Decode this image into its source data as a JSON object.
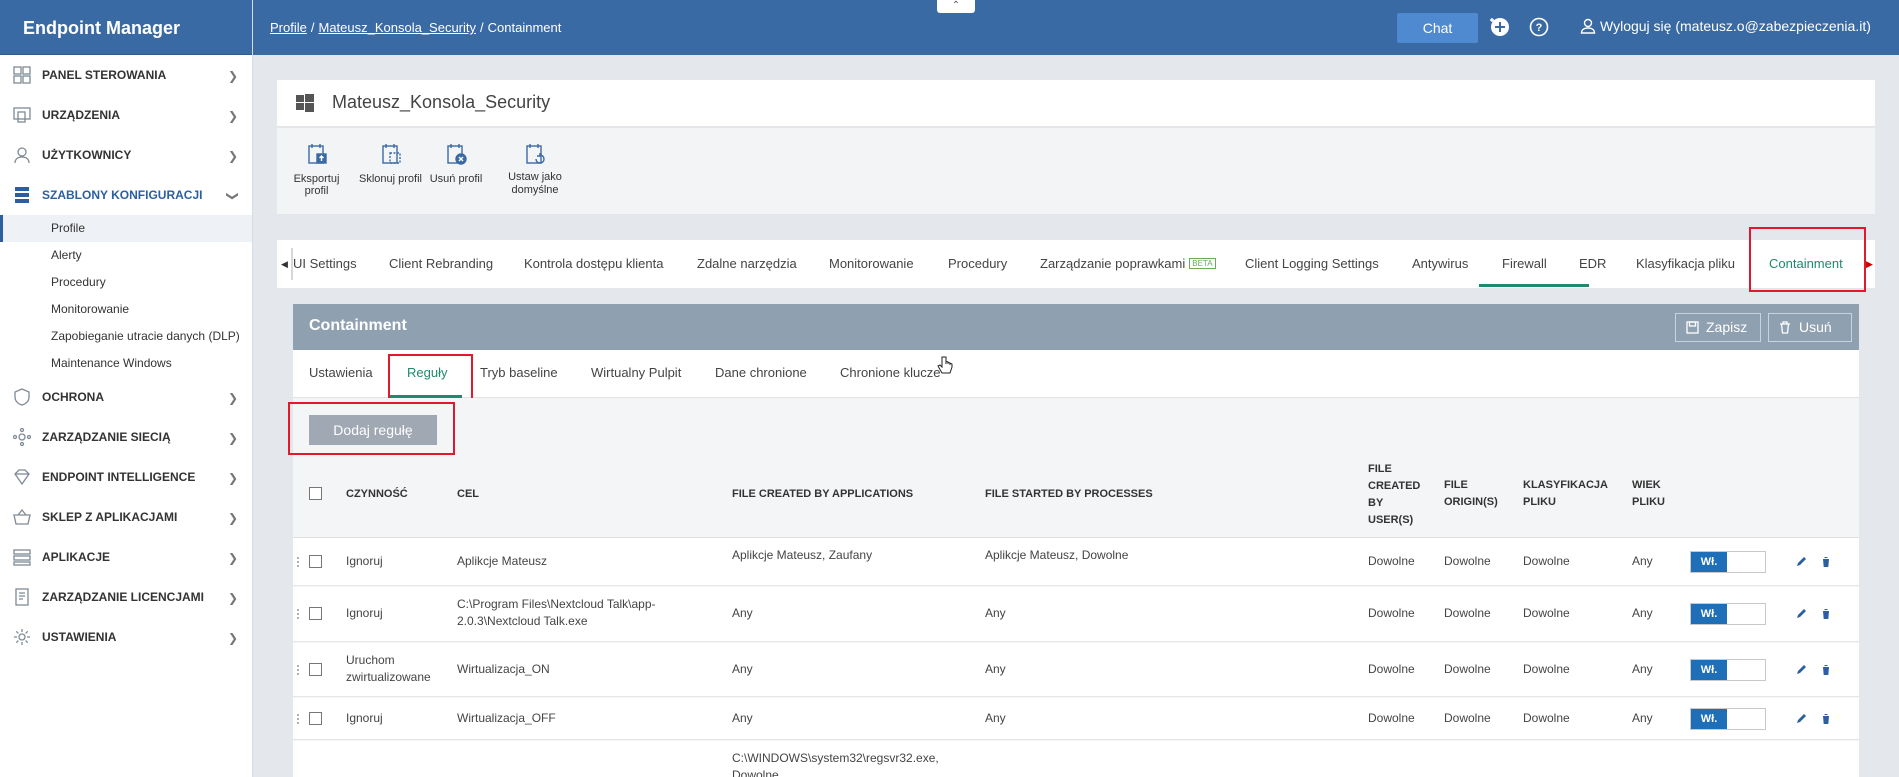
{
  "brand": "Endpoint Manager",
  "sidebar": {
    "items": [
      {
        "label": "PANEL STEROWANIA"
      },
      {
        "label": "URZĄDZENIA"
      },
      {
        "label": "UŻYTKOWNICY"
      },
      {
        "label": "SZABLONY KONFIGURACJI"
      },
      {
        "label": "OCHRONA"
      },
      {
        "label": "ZARZĄDZANIE SIECIĄ"
      },
      {
        "label": "ENDPOINT INTELLIGENCE"
      },
      {
        "label": "SKLEP Z APLIKACJAMI"
      },
      {
        "label": "APLIKACJE"
      },
      {
        "label": "ZARZĄDZANIE LICENCJAMI"
      },
      {
        "label": "USTAWIENIA"
      }
    ],
    "sub_items": [
      {
        "label": "Profile"
      },
      {
        "label": "Alerty"
      },
      {
        "label": "Procedury"
      },
      {
        "label": "Monitorowanie"
      },
      {
        "label": "Zapobieganie utracie danych (DLP)"
      },
      {
        "label": "Maintenance Windows"
      }
    ]
  },
  "topbar": {
    "breadcrumb": [
      "Profile",
      "Mateusz_Konsola_Security",
      "Containment"
    ],
    "chat": "Chat",
    "logout": "Wyloguj się (mateusz.o@zabezpieczenia.it)"
  },
  "profile": {
    "title": "Mateusz_Konsola_Security",
    "actions": {
      "export": "Eksportuj profil",
      "clone": "Sklonuj profil",
      "delete": "Usuń profil",
      "default_line1": "Ustaw jako",
      "default_line2": "domyślne"
    }
  },
  "tabs": [
    {
      "label": "UI Settings"
    },
    {
      "label": "Client Rebranding"
    },
    {
      "label": "Kontrola dostępu klienta"
    },
    {
      "label": "Zdalne narzędzia"
    },
    {
      "label": "Monitorowanie"
    },
    {
      "label": "Procedury"
    },
    {
      "label": "Zarządzanie poprawkami",
      "badge": "BETA"
    },
    {
      "label": "Client Logging Settings"
    },
    {
      "label": "Antywirus"
    },
    {
      "label": "Firewall"
    },
    {
      "label": "EDR"
    },
    {
      "label": "Klasyfikacja pliku"
    },
    {
      "label": "Containment"
    }
  ],
  "panel": {
    "title": "Containment",
    "save": "Zapisz",
    "remove": "Usuń"
  },
  "subtabs": [
    {
      "label": "Ustawienia"
    },
    {
      "label": "Reguły"
    },
    {
      "label": "Tryb baseline"
    },
    {
      "label": "Wirtualny Pulpit"
    },
    {
      "label": "Dane chronione"
    },
    {
      "label": "Chronione klucze"
    }
  ],
  "add_rule": "Dodaj regułę",
  "table": {
    "headers": {
      "action": "CZYNNOŚĆ",
      "target": "CEL",
      "created_by_apps": "FILE CREATED BY APPLICATIONS",
      "started_by": "FILE STARTED BY PROCESSES",
      "created_by_users": [
        "FILE",
        "CREATED",
        "BY",
        "USER(S)"
      ],
      "origin": [
        "FILE",
        "ORIGIN(S)"
      ],
      "classification": [
        "KLASYFIKACJA",
        "PLIKU"
      ],
      "age": [
        "WIEK",
        "PLIKU"
      ]
    },
    "rows": [
      {
        "action": "Ignoruj",
        "target": "Aplikcje Mateusz",
        "apps": "Aplikcje Mateusz, Zaufany",
        "started": "Aplikcje Mateusz, Dowolne",
        "users": "Dowolne",
        "origin": "Dowolne",
        "classification": "Dowolne",
        "age": "Any",
        "toggle": "Wł."
      },
      {
        "action": "Ignoruj",
        "target_line1": "C:\\Program Files\\Nextcloud Talk\\app-",
        "target_line2": "2.0.3\\Nextcloud Talk.exe",
        "apps": "Any",
        "started": "Any",
        "users": "Dowolne",
        "origin": "Dowolne",
        "classification": "Dowolne",
        "age": "Any",
        "toggle": "Wł."
      },
      {
        "action_line1": "Uruchom",
        "action_line2": "zwirtualizowane",
        "target": "Wirtualizacja_ON",
        "apps": "Any",
        "started": "Any",
        "users": "Dowolne",
        "origin": "Dowolne",
        "classification": "Dowolne",
        "age": "Any",
        "toggle": "Wł."
      },
      {
        "action": "Ignoruj",
        "target": "Wirtualizacja_OFF",
        "apps": "Any",
        "started": "Any",
        "users": "Dowolne",
        "origin": "Dowolne",
        "classification": "Dowolne",
        "age": "Any",
        "toggle": "Wł."
      },
      {
        "apps_line1": "C:\\WINDOWS\\system32\\regsvr32.exe,",
        "apps_line2": "Dowolne"
      }
    ]
  }
}
